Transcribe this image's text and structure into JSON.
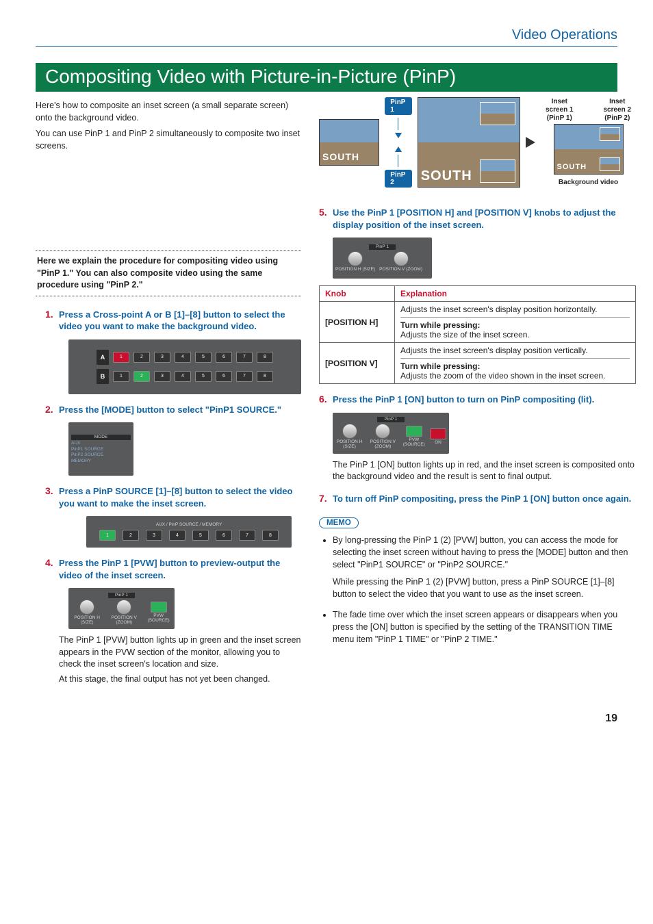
{
  "breadcrumb": "Video Operations",
  "title": "Compositing Video with Picture-in-Picture (PinP)",
  "intro1": "Here's how to composite an inset screen (a small separate screen) onto the background video.",
  "intro2": "You can use PinP 1 and PinP 2 simultaneously to composite two inset screens.",
  "note_box": "Here we explain the procedure for compositing video using \"PinP 1.\" You can also composite video using the same procedure using \"PinP 2.\"",
  "steps": {
    "s1": {
      "num": "1.",
      "text": "Press a Cross-point A or B [1]–[8] button to select the video you want to make the background video."
    },
    "s2": {
      "num": "2.",
      "text": "Press the [MODE] button to select \"PinP1 SOURCE.\""
    },
    "s3": {
      "num": "3.",
      "text": "Press a PinP SOURCE [1]–[8] button to select the video you want to make the inset screen."
    },
    "s4": {
      "num": "4.",
      "text": "Press the PinP 1 [PVW] button to preview-output the video of the inset screen.",
      "body1": "The PinP 1 [PVW] button lights up in green and the inset screen appears in the PVW section of the monitor, allowing you to check the inset screen's location and size.",
      "body2": "At this stage, the final output has not yet been changed."
    },
    "s5": {
      "num": "5.",
      "text": "Use the PinP 1 [POSITION H] and [POSITION V] knobs to adjust the display position of the inset screen."
    },
    "s6": {
      "num": "6.",
      "text": "Press the PinP 1 [ON] button to turn on PinP compositing (lit).",
      "body1": "The PinP 1 [ON] button lights up in red, and the inset screen is composited onto the background video and the result is sent to final output."
    },
    "s7": {
      "num": "7.",
      "text": "To turn off PinP compositing, press the PinP 1 [ON] button once again."
    }
  },
  "knob_table": {
    "h1": "Knob",
    "h2": "Explanation",
    "r1": {
      "name": "[POSITION H]",
      "line1": "Adjusts the inset screen's display position horizontally.",
      "turn": "Turn while pressing:",
      "line2": "Adjusts the size of the inset screen."
    },
    "r2": {
      "name": "[POSITION V]",
      "line1": "Adjusts the inset screen's display position vertically.",
      "turn": "Turn while pressing:",
      "line2": "Adjusts the zoom of the video shown in the inset screen."
    }
  },
  "diagram": {
    "pinp1": "PinP 1",
    "pinp2": "PinP 2",
    "inset1a": "Inset screen 1",
    "inset1b": "(PinP 1)",
    "inset2a": "Inset screen 2",
    "inset2b": "(PinP 2)",
    "bg": "Background video",
    "south": "SOUTH"
  },
  "memo": {
    "label": "MEMO",
    "items": [
      "By long-pressing the PinP 1 (2) [PVW] button, you can access the mode for selecting the inset screen without having to press the [MODE] button and then select \"PinP1 SOURCE\" or \"PinP2 SOURCE.\"",
      "While pressing the PinP 1 (2) [PVW] button, press a PinP SOURCE [1]–[8] button to select the video that you want to use as the inset screen.",
      "The fade time over which the inset screen appears or disappears when you press the [ON] button is specified by the setting of the TRANSITION TIME menu item \"PinP 1 TIME\" or \"PinP 2 TIME.\""
    ]
  },
  "fig_labels": {
    "row_a": "A",
    "row_b": "B",
    "buttons": [
      "1",
      "2",
      "3",
      "4",
      "5",
      "6",
      "7",
      "8"
    ],
    "mode_title": "MODE",
    "mode_items": [
      "AUX",
      "PinP1 SOURCE",
      "PinP2 SOURCE",
      "MEMORY"
    ],
    "source_title": "AUX / PinP SOURCE / MEMORY",
    "pinp_panel": "PinP 1",
    "pos_h": "POSITION H\n(SIZE)",
    "pos_v": "POSITION V\n(ZOOM)",
    "pvw": "PVW\n(SOURCE)",
    "on": "ON"
  },
  "page_number": "19"
}
